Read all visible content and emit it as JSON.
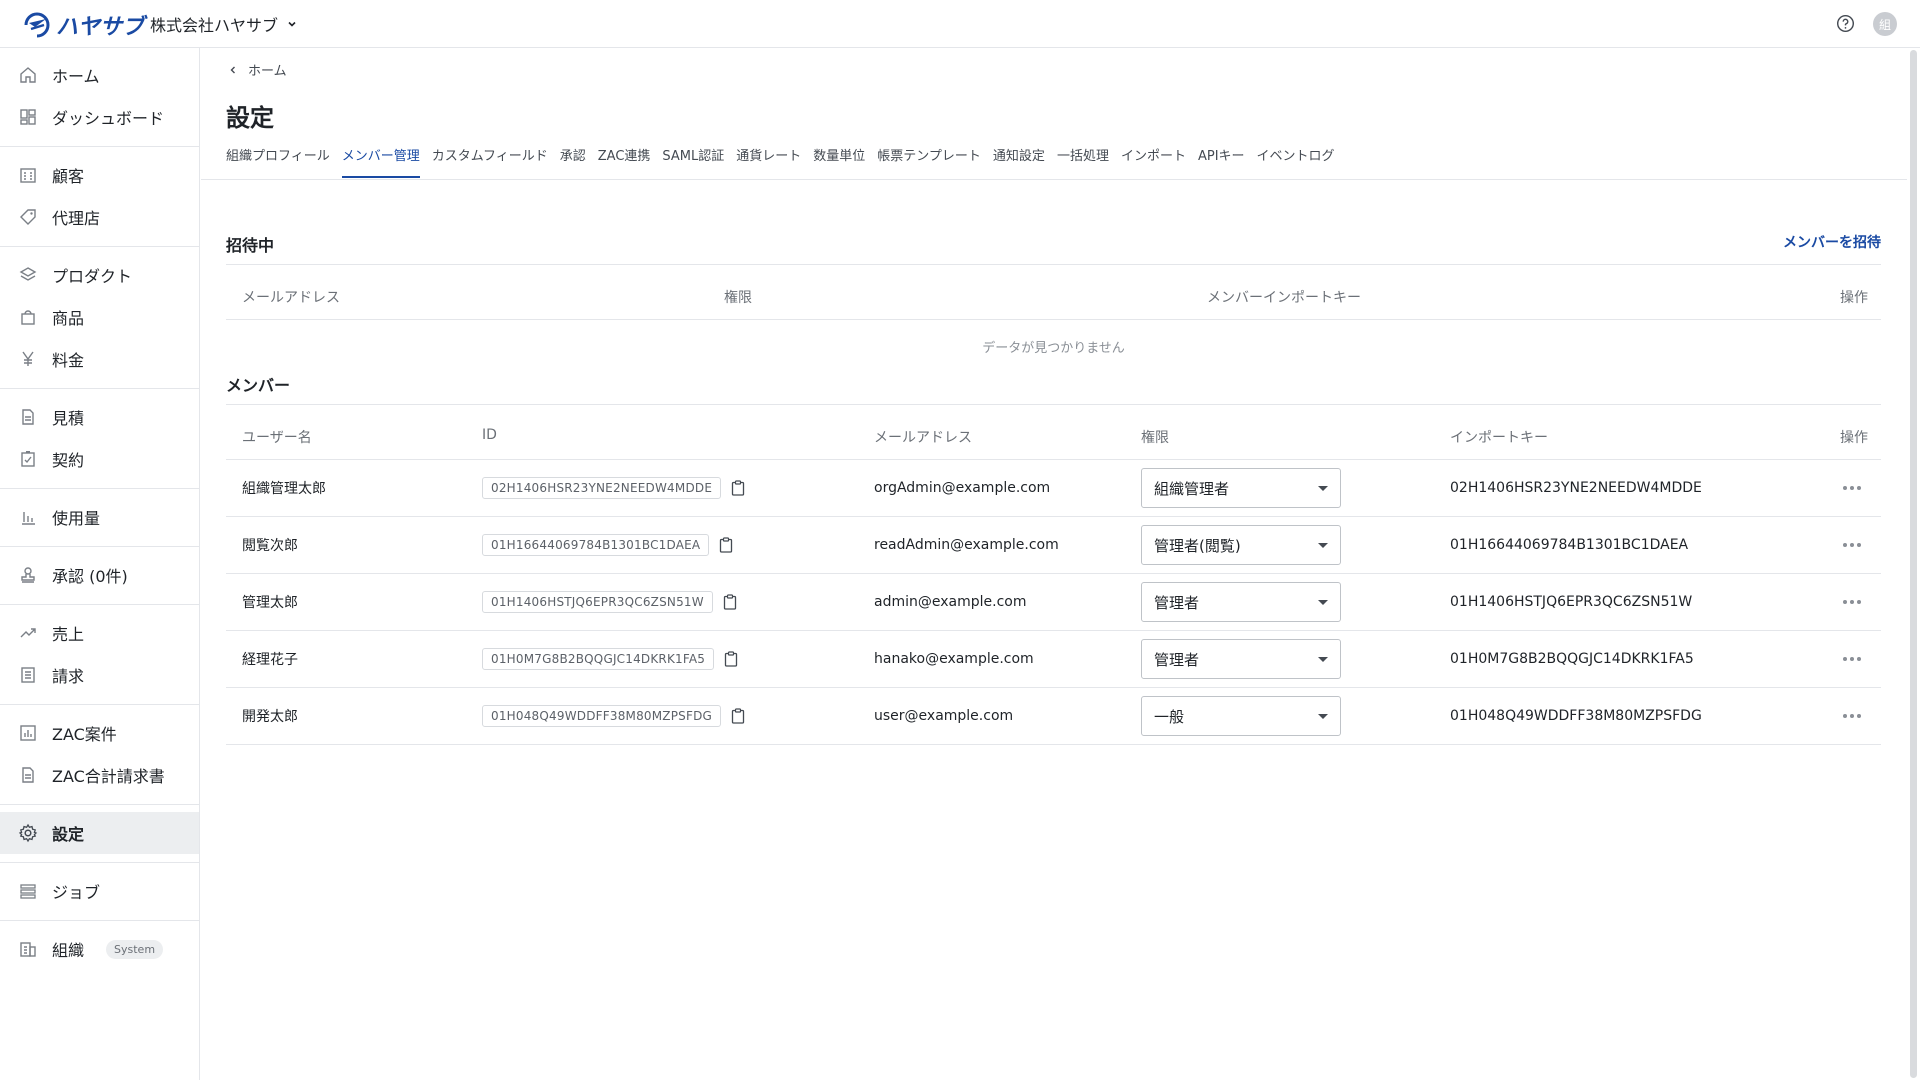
{
  "header": {
    "logo_text": "ハヤサブ",
    "org_name": "株式会社ハヤサブ",
    "avatar_initial": "組"
  },
  "sidebar": {
    "items": [
      {
        "label": "ホーム",
        "icon": "home-icon"
      },
      {
        "label": "ダッシュボード",
        "icon": "dashboard-icon"
      },
      {
        "label": "顧客",
        "icon": "building-icon"
      },
      {
        "label": "代理店",
        "icon": "tag-icon"
      },
      {
        "label": "プロダクト",
        "icon": "layers-icon"
      },
      {
        "label": "商品",
        "icon": "bag-icon"
      },
      {
        "label": "料金",
        "icon": "yen-icon"
      },
      {
        "label": "見積",
        "icon": "document-icon"
      },
      {
        "label": "契約",
        "icon": "contract-icon"
      },
      {
        "label": "使用量",
        "icon": "bar-chart-icon"
      },
      {
        "label": "承認 (0件)",
        "icon": "stamp-icon"
      },
      {
        "label": "売上",
        "icon": "trend-icon"
      },
      {
        "label": "請求",
        "icon": "list-icon"
      },
      {
        "label": "ZAC案件",
        "icon": "chart-box-icon"
      },
      {
        "label": "ZAC合計請求書",
        "icon": "document-icon"
      },
      {
        "label": "設定",
        "icon": "gear-icon"
      },
      {
        "label": "ジョブ",
        "icon": "stack-icon"
      },
      {
        "label": "組織",
        "icon": "building-icon"
      }
    ],
    "system_badge": "System"
  },
  "breadcrumb": {
    "label": "ホーム"
  },
  "page": {
    "title": "設定"
  },
  "tabs": [
    "組織プロフィール",
    "メンバー管理",
    "カスタムフィールド",
    "承認",
    "ZAC連携",
    "SAML認証",
    "通貨レート",
    "数量単位",
    "帳票テンプレート",
    "通知設定",
    "一括処理",
    "インポート",
    "APIキー",
    "イベントログ"
  ],
  "invited": {
    "title": "招待中",
    "invite_button": "メンバーを招待",
    "columns": [
      "メールアドレス",
      "権限",
      "メンバーインポートキー",
      "操作"
    ],
    "empty_text": "データが見つかりません"
  },
  "members": {
    "title": "メンバー",
    "columns": [
      "ユーザー名",
      "ID",
      "メールアドレス",
      "権限",
      "インポートキー",
      "操作"
    ],
    "rows": [
      {
        "name": "組織管理太郎",
        "id": "02H1406HSR23YNE2NEEDW4MDDE",
        "email": "orgAdmin@example.com",
        "role": "組織管理者",
        "import_key": "02H1406HSR23YNE2NEEDW4MDDE"
      },
      {
        "name": "閲覧次郎",
        "id": "01H16644069784B1301BC1DAEA",
        "email": "readAdmin@example.com",
        "role": "管理者(閲覧)",
        "import_key": "01H16644069784B1301BC1DAEA"
      },
      {
        "name": "管理太郎",
        "id": "01H1406HSTJQ6EPR3QC6ZSN51W",
        "email": "admin@example.com",
        "role": "管理者",
        "import_key": "01H1406HSTJQ6EPR3QC6ZSN51W"
      },
      {
        "name": "経理花子",
        "id": "01H0M7G8B2BQQGJC14DKRK1FA5",
        "email": "hanako@example.com",
        "role": "管理者",
        "import_key": "01H0M7G8B2BQQGJC14DKRK1FA5"
      },
      {
        "name": "開発太郎",
        "id": "01H048Q49WDDFF38M80MZPSFDG",
        "email": "user@example.com",
        "role": "一般",
        "import_key": "01H048Q49WDDFF38M80MZPSFDG"
      }
    ]
  },
  "colors": {
    "accent": "#1a4aa3",
    "border": "#e4e6ea",
    "muted": "#6b7077"
  }
}
